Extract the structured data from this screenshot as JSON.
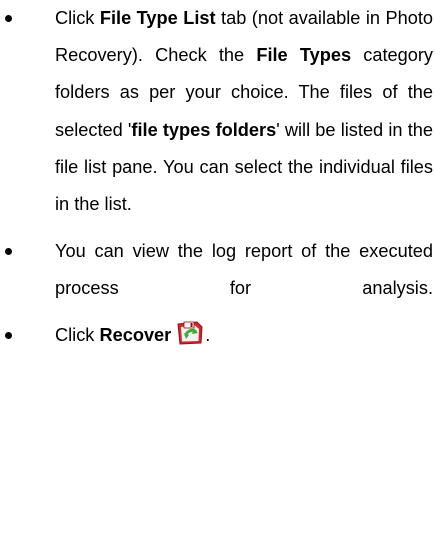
{
  "bullets": [
    {
      "text_1": "Click ",
      "bold_1": "File Type List",
      "text_2": " tab (not available in Photo Recovery). Check the ",
      "bold_2": "File Types",
      "text_3": " category folders as per your choice. The files of the selected '",
      "bold_3": "file types folders",
      "text_4": "' will be listed in the file list pane. You can select the individual files in the list."
    },
    {
      "text_1": "You can view the log report of the executed process for analysis."
    },
    {
      "text_1": "Click ",
      "bold_1": "Recover",
      "icon": "recover-icon",
      "text_2": "."
    }
  ],
  "colors": {
    "text": "#000000",
    "icon_red": "#d7262a",
    "icon_arrow": "#3cae3a"
  }
}
